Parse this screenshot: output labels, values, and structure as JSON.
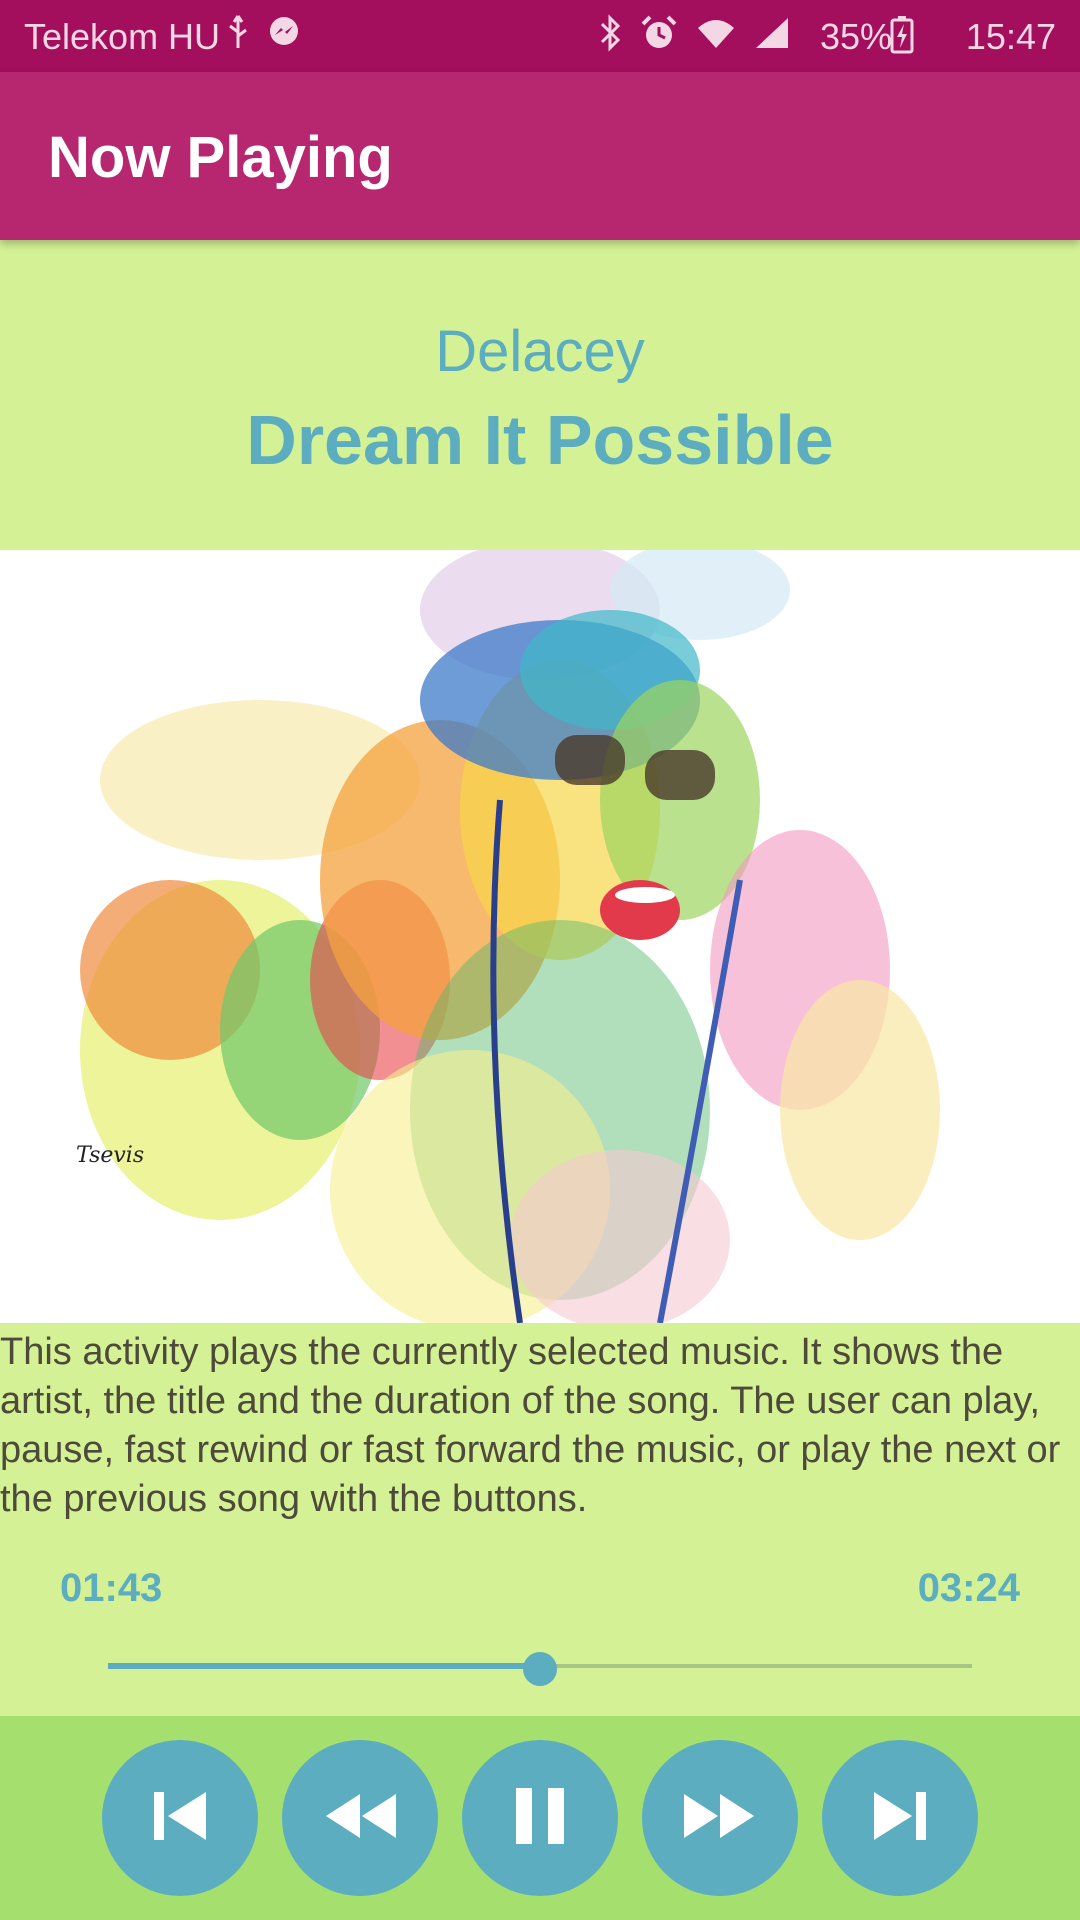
{
  "status_bar": {
    "carrier": "Telekom HU",
    "battery": "35%",
    "time": "15:47",
    "icons": [
      "usb-icon",
      "messenger-icon",
      "bluetooth-icon",
      "alarm-icon",
      "wifi-icon",
      "signal-icon",
      "battery-charging-icon"
    ]
  },
  "app_bar": {
    "title": "Now Playing"
  },
  "song": {
    "artist": "Delacey",
    "title": "Dream It Possible"
  },
  "description": "This activity plays the currently selected music. It shows the artist, the title and the duration of the song. The user can play, pause, fast rewind or fast forward the music, or play the next or the previous song with the buttons.",
  "player": {
    "current_time": "01:43",
    "total_time": "03:24",
    "progress_fraction": 0.5
  },
  "controls": [
    "previous-icon",
    "rewind-icon",
    "pause-icon",
    "fast-forward-icon",
    "next-icon"
  ],
  "colors": {
    "status_bar": "#a30f5c",
    "app_bar": "#b7276f",
    "background": "#d4f295",
    "controls_bar": "#a5e06e",
    "accent": "#5badbf",
    "text": "#4e4a3b"
  }
}
